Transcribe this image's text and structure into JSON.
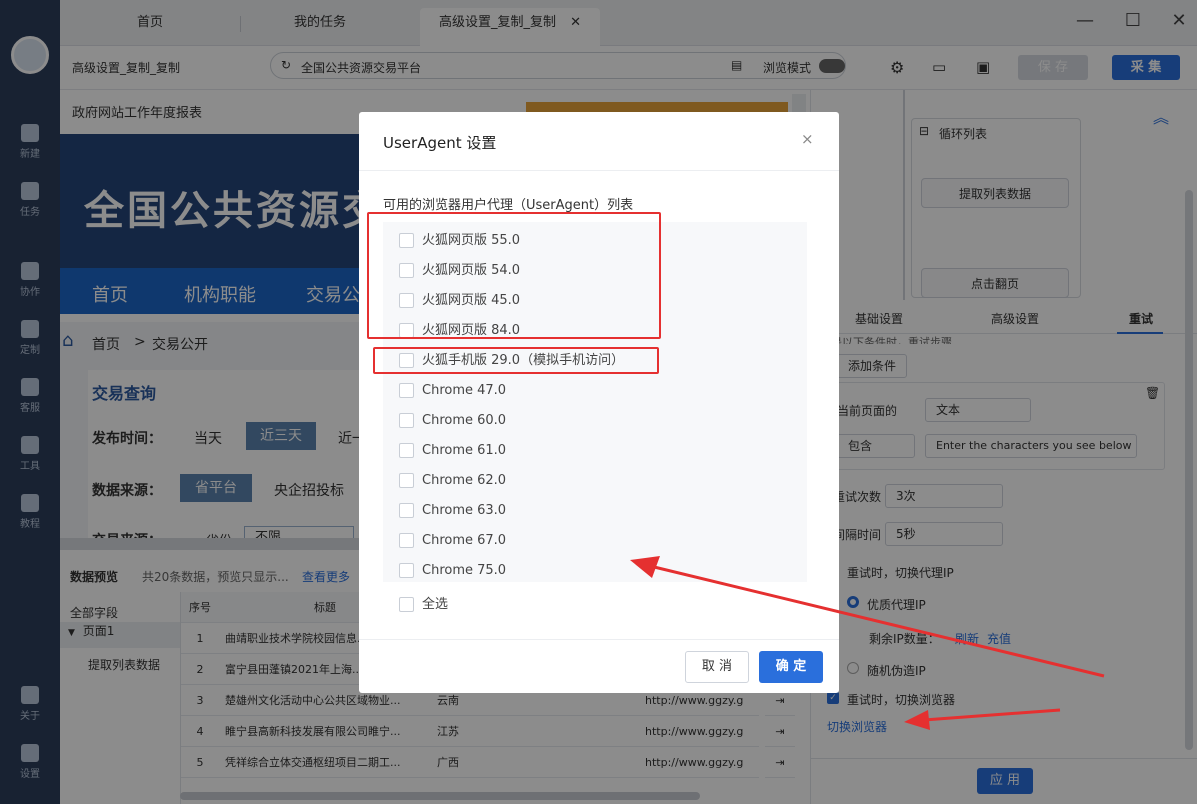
{
  "tabs": [
    {
      "label": "首页"
    },
    {
      "label": "我的任务"
    },
    {
      "label": "高级设置_复制_复制"
    }
  ],
  "rail": [
    {
      "label": "新建"
    },
    {
      "label": "任务"
    },
    {
      "label": "协作"
    },
    {
      "label": "定制"
    },
    {
      "label": "客服"
    },
    {
      "label": "工具"
    },
    {
      "label": "教程"
    },
    {
      "label": "关于"
    },
    {
      "label": "设置"
    }
  ],
  "toolbar": {
    "task_name": "高级设置_复制_复制",
    "address": "全国公共资源交易平台",
    "browse_mode": "浏览模式",
    "save": "保 存",
    "collect": "采 集"
  },
  "page": {
    "top_text": "政府网站工作年度报表",
    "banner_title": "全国公共资源交",
    "nav": [
      "首页",
      "机构职能",
      "交易公"
    ],
    "crumb_home": "首页",
    "crumb_sep": ">",
    "crumb_cur": "交易公开",
    "query_title": "交易查询",
    "pub_time_label": "发布时间：",
    "pub_time_opts": [
      "当天",
      "近三天",
      "近一"
    ],
    "src_label": "数据来源：",
    "src_opts": [
      "省平台",
      "央企招投标"
    ],
    "trade_src_label": "交易来源：",
    "trade_src_val": "省份",
    "trade_src_sel": "不限"
  },
  "preview": {
    "title": "数据预览",
    "summary": "共20条数据，预览只显示...",
    "more": "查看更多",
    "tree_all": "全部字段",
    "tree_page": "页面1",
    "tree_item": "提取列表数据",
    "col_no": "序号",
    "col_title": "标题",
    "rows": [
      {
        "no": "1",
        "title": "曲靖职业技术学院校园信息...",
        "region": "",
        "url": ""
      },
      {
        "no": "2",
        "title": "富宁县田蓬镇2021年上海...",
        "region": "",
        "url": ""
      },
      {
        "no": "3",
        "title": "楚雄州文化活动中心公共区域物业...",
        "region": "云南",
        "url": "http://www.ggzy.g"
      },
      {
        "no": "4",
        "title": "睢宁县高新科技发展有限公司睢宁...",
        "region": "江苏",
        "url": "http://www.ggzy.g"
      },
      {
        "no": "5",
        "title": "凭祥综合立体交通枢纽项目二期工...",
        "region": "广西",
        "url": "http://www.ggzy.g"
      }
    ]
  },
  "flow": {
    "loop": "循环列表",
    "extract": "提取列表数据",
    "page": "点击翻页"
  },
  "rtabs": [
    "基础设置",
    "高级设置",
    "重试"
  ],
  "retry": {
    "cond_hint": "是以下条件时，重试步骤",
    "add_cond": "添加条件",
    "cur_page": "当前页面的",
    "text_sel": "文本",
    "contains_sel": "包含",
    "contains_val": "Enter the characters you see below",
    "times_label": "重试次数",
    "times_val": "3次",
    "interval_label": "间隔时间",
    "interval_val": "5秒",
    "proxy_label": "重试时，切换代理IP",
    "quality_proxy": "优质代理IP",
    "remain_ip": "剩余IP数量：",
    "refresh": "刷新",
    "recharge": "充值",
    "random_ip": "随机伪造IP",
    "switch_browser": "重试时，切换浏览器",
    "switch_link": "切换浏览器",
    "apply": "应 用"
  },
  "modal": {
    "title": "UserAgent 设置",
    "subtitle": "可用的浏览器用户代理（UserAgent）列表",
    "options": [
      "火狐网页版 55.0",
      "火狐网页版 54.0",
      "火狐网页版 45.0",
      "火狐网页版 84.0",
      "火狐手机版 29.0（模拟手机访问）",
      "Chrome 47.0",
      "Chrome 60.0",
      "Chrome 61.0",
      "Chrome 62.0",
      "Chrome 63.0",
      "Chrome 67.0",
      "Chrome 75.0"
    ],
    "select_all": "全选",
    "cancel": "取 消",
    "ok": "确 定"
  },
  "colors": {
    "accent": "#2a6fdc",
    "annotation": "#e53030",
    "rail": "#2c3e5c"
  }
}
